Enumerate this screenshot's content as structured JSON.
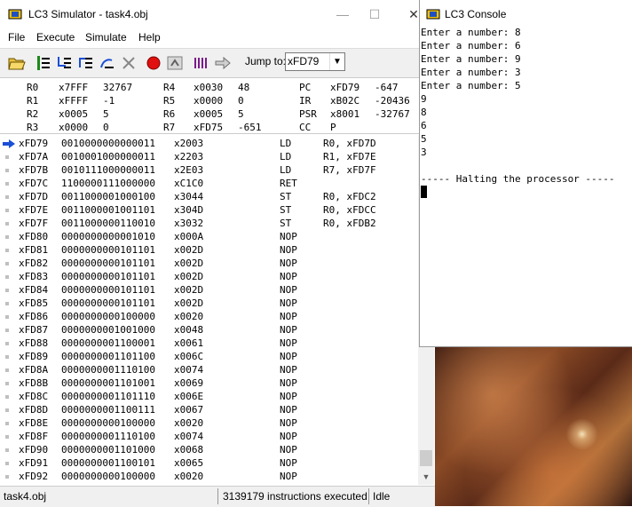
{
  "simulator": {
    "title": "LC3 Simulator - task4.obj",
    "window_buttons": {
      "minimize": "—",
      "maximize": "☐",
      "close": "✕"
    },
    "menu": [
      "File",
      "Execute",
      "Simulate",
      "Help"
    ],
    "toolbar": {
      "buttons": [
        "open-folder",
        "step-over",
        "step-into",
        "step-out",
        "run",
        "clear",
        "stop",
        "reset",
        "registers",
        "goto"
      ],
      "jump_label": "Jump to:",
      "jump_value": "xFD79"
    },
    "registers": [
      [
        "R0",
        "x7FFF",
        "32767",
        "R4",
        "x0030",
        "48",
        "PC",
        "xFD79",
        "-647"
      ],
      [
        "R1",
        "xFFFF",
        "-1",
        "R5",
        "x0000",
        "0",
        "IR",
        "xB02C",
        "-20436"
      ],
      [
        "R2",
        "x0005",
        "5",
        "R6",
        "x0005",
        "5",
        "PSR",
        "x8001",
        "-32767"
      ],
      [
        "R3",
        "x0000",
        "0",
        "R7",
        "xFD75",
        "-651",
        "CC",
        "P",
        ""
      ]
    ],
    "memory": [
      {
        "addr": "xFD79",
        "bin": "0010000000000011",
        "hex": "x2003",
        "op": "LD",
        "arg": "R0, xFD7D",
        "pc": true
      },
      {
        "addr": "xFD7A",
        "bin": "0010001000000011",
        "hex": "x2203",
        "op": "LD",
        "arg": "R1, xFD7E"
      },
      {
        "addr": "xFD7B",
        "bin": "0010111000000011",
        "hex": "x2E03",
        "op": "LD",
        "arg": "R7, xFD7F"
      },
      {
        "addr": "xFD7C",
        "bin": "1100000111000000",
        "hex": "xC1C0",
        "op": "RET",
        "arg": ""
      },
      {
        "addr": "xFD7D",
        "bin": "0011000001000100",
        "hex": "x3044",
        "op": "ST",
        "arg": "R0, xFDC2"
      },
      {
        "addr": "xFD7E",
        "bin": "0011000001001101",
        "hex": "x304D",
        "op": "ST",
        "arg": "R0, xFDCC"
      },
      {
        "addr": "xFD7F",
        "bin": "0011000000110010",
        "hex": "x3032",
        "op": "ST",
        "arg": "R0, xFDB2"
      },
      {
        "addr": "xFD80",
        "bin": "0000000000001010",
        "hex": "x000A",
        "op": "NOP",
        "arg": ""
      },
      {
        "addr": "xFD81",
        "bin": "0000000000101101",
        "hex": "x002D",
        "op": "NOP",
        "arg": ""
      },
      {
        "addr": "xFD82",
        "bin": "0000000000101101",
        "hex": "x002D",
        "op": "NOP",
        "arg": ""
      },
      {
        "addr": "xFD83",
        "bin": "0000000000101101",
        "hex": "x002D",
        "op": "NOP",
        "arg": ""
      },
      {
        "addr": "xFD84",
        "bin": "0000000000101101",
        "hex": "x002D",
        "op": "NOP",
        "arg": ""
      },
      {
        "addr": "xFD85",
        "bin": "0000000000101101",
        "hex": "x002D",
        "op": "NOP",
        "arg": ""
      },
      {
        "addr": "xFD86",
        "bin": "0000000000100000",
        "hex": "x0020",
        "op": "NOP",
        "arg": ""
      },
      {
        "addr": "xFD87",
        "bin": "0000000001001000",
        "hex": "x0048",
        "op": "NOP",
        "arg": ""
      },
      {
        "addr": "xFD88",
        "bin": "0000000001100001",
        "hex": "x0061",
        "op": "NOP",
        "arg": ""
      },
      {
        "addr": "xFD89",
        "bin": "0000000001101100",
        "hex": "x006C",
        "op": "NOP",
        "arg": ""
      },
      {
        "addr": "xFD8A",
        "bin": "0000000001110100",
        "hex": "x0074",
        "op": "NOP",
        "arg": ""
      },
      {
        "addr": "xFD8B",
        "bin": "0000000001101001",
        "hex": "x0069",
        "op": "NOP",
        "arg": ""
      },
      {
        "addr": "xFD8C",
        "bin": "0000000001101110",
        "hex": "x006E",
        "op": "NOP",
        "arg": ""
      },
      {
        "addr": "xFD8D",
        "bin": "0000000001100111",
        "hex": "x0067",
        "op": "NOP",
        "arg": ""
      },
      {
        "addr": "xFD8E",
        "bin": "0000000000100000",
        "hex": "x0020",
        "op": "NOP",
        "arg": ""
      },
      {
        "addr": "xFD8F",
        "bin": "0000000001110100",
        "hex": "x0074",
        "op": "NOP",
        "arg": ""
      },
      {
        "addr": "xFD90",
        "bin": "0000000001101000",
        "hex": "x0068",
        "op": "NOP",
        "arg": ""
      },
      {
        "addr": "xFD91",
        "bin": "0000000001100101",
        "hex": "x0065",
        "op": "NOP",
        "arg": ""
      },
      {
        "addr": "xFD92",
        "bin": "0000000000100000",
        "hex": "x0020",
        "op": "NOP",
        "arg": ""
      }
    ],
    "status": {
      "file": "task4.obj",
      "instructions": "3139179 instructions executed",
      "state": "Idle"
    }
  },
  "console": {
    "title": "LC3 Console",
    "lines": [
      "Enter a number: 8",
      "Enter a number: 6",
      "Enter a number: 9",
      "Enter a number: 3",
      "Enter a number: 5",
      "9",
      "8",
      "6",
      "5",
      "3",
      "",
      "----- Halting the processor -----"
    ]
  },
  "colors": {
    "pc_arrow": "#1a4fd6",
    "stop_red": "#e01010"
  }
}
